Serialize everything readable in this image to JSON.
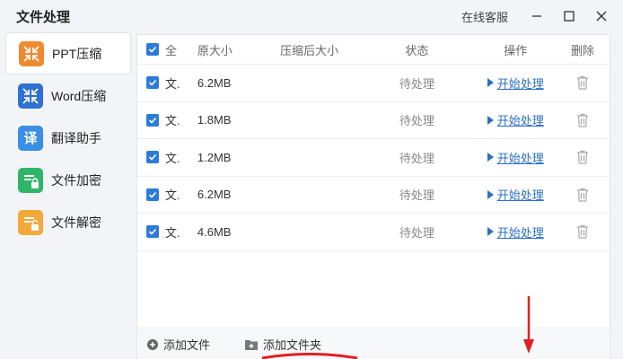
{
  "app": {
    "title": "文件处理",
    "support": "在线客服"
  },
  "sidebar": {
    "items": [
      {
        "label": "PPT压缩",
        "icon": "compress-icon",
        "color": "#f08a2e"
      },
      {
        "label": "Word压缩",
        "icon": "compress-icon",
        "color": "#2f6fd6"
      },
      {
        "label": "翻译助手",
        "icon": "translate-icon",
        "color": "#3a8ee6",
        "glyph": "译"
      },
      {
        "label": "文件加密",
        "icon": "lock-file-icon",
        "color": "#2fb56a"
      },
      {
        "label": "文件解密",
        "icon": "unlock-file-icon",
        "color": "#f3a93a"
      }
    ]
  },
  "table": {
    "headers": {
      "select_all": "全",
      "original_size": "原大小",
      "compressed_size": "压缩后大小",
      "status": "状态",
      "operation": "操作",
      "delete": "删除"
    },
    "rows": [
      {
        "name": "文.",
        "size": "6.2MB",
        "compressed": "",
        "status": "待处理",
        "action": "开始处理"
      },
      {
        "name": "文.",
        "size": "1.8MB",
        "compressed": "",
        "status": "待处理",
        "action": "开始处理"
      },
      {
        "name": "文.",
        "size": "1.2MB",
        "compressed": "",
        "status": "待处理",
        "action": "开始处理"
      },
      {
        "name": "文.",
        "size": "6.2MB",
        "compressed": "",
        "status": "待处理",
        "action": "开始处理"
      },
      {
        "name": "文.",
        "size": "4.6MB",
        "compressed": "",
        "status": "待处理",
        "action": "开始处理"
      }
    ]
  },
  "footer": {
    "add_file": "添加文件",
    "add_folder": "添加文件夹"
  },
  "colors": {
    "accent": "#2d7bd8",
    "link": "#2a6fc9",
    "annotation": "#e02020"
  }
}
